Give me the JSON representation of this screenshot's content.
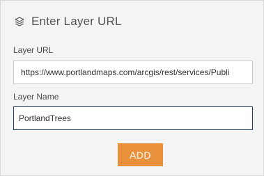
{
  "panel": {
    "title": "Enter Layer URL",
    "title_icon": "layers-icon"
  },
  "form": {
    "url_label": "Layer URL",
    "url_value": "https://www.portlandmaps.com/arcgis/rest/services/Publi",
    "name_label": "Layer Name",
    "name_value": "PortlandTrees",
    "add_label": "ADD"
  },
  "colors": {
    "panel_bg": "#f4f4f4",
    "button_bg": "#e8913a",
    "focus_border": "#1e3f66"
  }
}
